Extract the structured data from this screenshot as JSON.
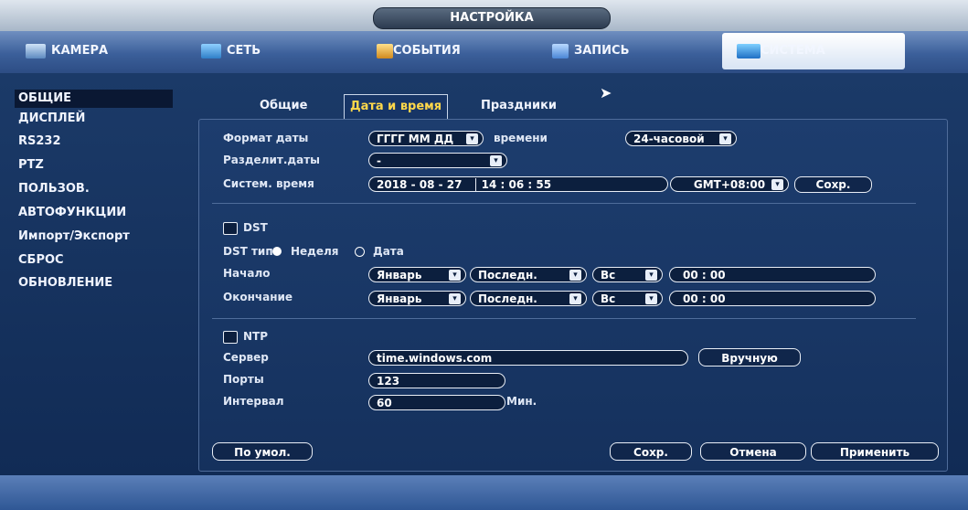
{
  "title": "НАСТРОЙКА",
  "tabs": [
    {
      "label": "КАМЕРА",
      "icon": "camera-icon"
    },
    {
      "label": "СЕТЬ",
      "icon": "network-icon"
    },
    {
      "label": "СОБЫТИЯ",
      "icon": "events-icon"
    },
    {
      "label": "ЗАПИСЬ",
      "icon": "record-icon"
    },
    {
      "label": "СИСТЕМА",
      "icon": "system-icon",
      "active": true
    }
  ],
  "sidebar": [
    {
      "label": "ОБЩИЕ",
      "active": true
    },
    {
      "label": "ДИСПЛЕЙ"
    },
    {
      "label": "RS232"
    },
    {
      "label": "PTZ"
    },
    {
      "label": "ПОЛЬЗОВ."
    },
    {
      "label": "АВТОФУНКЦИИ"
    },
    {
      "label": "Импорт/Экспорт"
    },
    {
      "label": "СБРОС"
    },
    {
      "label": "ОБНОВЛЕНИЕ"
    }
  ],
  "subtabs": [
    "Общие",
    "Дата и время",
    "Праздники"
  ],
  "form": {
    "date_format_label": "Формат даты",
    "date_format_value": "ГГГГ ММ ДД",
    "time_label": "времени",
    "time_format_value": "24-часовой",
    "date_sep_label": "Разделит.даты",
    "date_sep_value": "-",
    "sys_time_label": "Систем. время",
    "sys_date": "2018 - 08 - 27",
    "sys_time": "14 : 06 : 55",
    "timezone": "GMT+08:00",
    "save_small": "Сохр.",
    "dst_label": "DST",
    "dst_type_label": "DST тип",
    "dst_week": "Неделя",
    "dst_date": "Дата",
    "start_label": "Начало",
    "end_label": "Окончание",
    "month": "Январь",
    "week": "Последн.",
    "day": "Вс",
    "time_val": "00 :  00",
    "ntp_label": "NTP",
    "server_label": "Сервер",
    "server_value": "time.windows.com",
    "manual_btn": "Вручную",
    "port_label": "Порты",
    "port_value": "123",
    "interval_label": "Интервал",
    "interval_value": "60",
    "interval_unit": "Мин."
  },
  "buttons": {
    "default": "По умол.",
    "save": "Сохр.",
    "cancel": "Отмена",
    "apply": "Применить"
  }
}
